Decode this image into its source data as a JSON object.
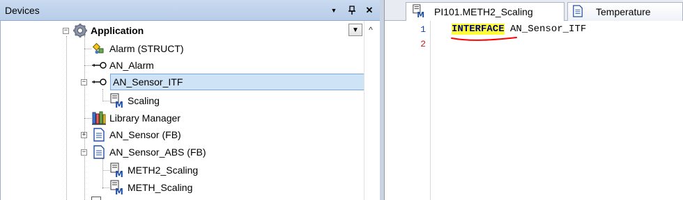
{
  "devices_pane": {
    "title": "Devices",
    "header_buttons": {
      "dropdown": "▼",
      "pin": "ф",
      "close": "✕"
    },
    "scroll_up": "^",
    "tree_dropdown": "▼"
  },
  "tree": {
    "root": {
      "label": "Application",
      "expander": "−",
      "icon": "gear-icon"
    },
    "items": [
      {
        "label": "Alarm (STRUCT)",
        "icon": "struct-icon"
      },
      {
        "label": "AN_Alarm",
        "icon": "interface-icon"
      },
      {
        "label": "AN_Sensor_ITF",
        "icon": "interface-icon",
        "expander": "−",
        "selected": true
      },
      {
        "label": "Scaling",
        "icon": "method-icon"
      },
      {
        "label": "Library Manager",
        "icon": "library-icon"
      },
      {
        "label": "AN_Sensor (FB)",
        "icon": "pou-icon",
        "expander": "+"
      },
      {
        "label": "AN_Sensor_ABS (FB)",
        "icon": "pou-icon",
        "expander": "−"
      },
      {
        "label": "METH2_Scaling",
        "icon": "method-icon"
      },
      {
        "label": "METH_Scaling",
        "icon": "method-icon"
      }
    ]
  },
  "editor": {
    "tabs": [
      {
        "label": "PI101.METH2_Scaling",
        "icon": "method-icon"
      },
      {
        "label": "Temperature",
        "icon": "document-icon"
      }
    ],
    "lines": [
      {
        "number": "1",
        "keyword": "INTERFACE",
        "rest": " AN_Sensor_ITF"
      },
      {
        "number": "2",
        "keyword": "",
        "rest": ""
      }
    ]
  },
  "colors": {
    "keyword_highlight": "#ffff33",
    "keyword_text": "#000080",
    "selection_bg": "#cfe3f7",
    "annotation_underline": "#ff0000",
    "line_number_1": "#1a3ea8",
    "line_number_2": "#c81e1e"
  }
}
